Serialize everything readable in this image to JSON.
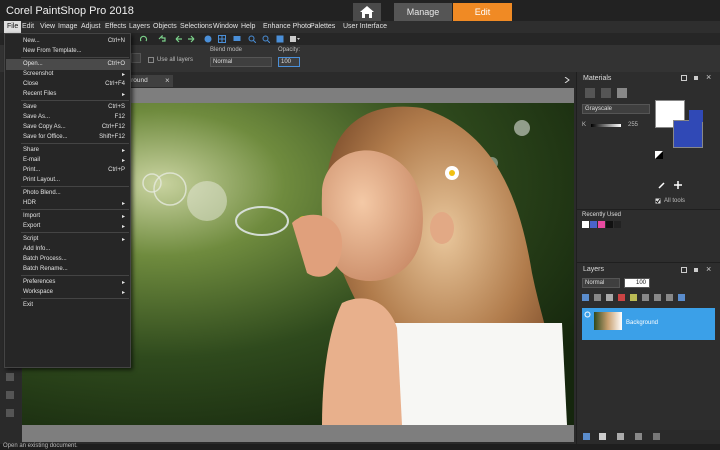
{
  "app": {
    "title": "Corel PaintShop Pro 2018",
    "home_icon": "home-icon",
    "tabs": [
      "Manage",
      "Edit"
    ],
    "active_tab": "Edit",
    "accent": "#f08a24"
  },
  "menubar": [
    "File",
    "Edit",
    "View",
    "Image",
    "Adjust",
    "Effects",
    "Layers",
    "Objects",
    "Selections",
    "Window",
    "Help",
    "Enhance Photo",
    "Palettes",
    "User Interface"
  ],
  "options": {
    "use_all_layers": "Use all layers",
    "blend_mode_label": "Blend mode",
    "blend_mode_value": "Normal",
    "opacity_label": "Opacity:",
    "opacity_value": "100"
  },
  "document": {
    "tab_name": "Background"
  },
  "file_menu": [
    {
      "label": "New...",
      "shortcut": "Ctrl+N"
    },
    {
      "label": "New From Template..."
    },
    {
      "sep": true
    },
    {
      "label": "Open...",
      "shortcut": "Ctrl+O",
      "highlighted": true
    },
    {
      "label": "Screenshot",
      "submenu": true
    },
    {
      "label": "Close",
      "shortcut": "Ctrl+F4"
    },
    {
      "label": "Recent Files",
      "submenu": true
    },
    {
      "sep": true
    },
    {
      "label": "Save",
      "shortcut": "Ctrl+S"
    },
    {
      "label": "Save As...",
      "shortcut": "F12"
    },
    {
      "label": "Save Copy As...",
      "shortcut": "Ctrl+F12"
    },
    {
      "label": "Save for Office...",
      "shortcut": "Shift+F12"
    },
    {
      "sep": true
    },
    {
      "label": "Share",
      "submenu": true
    },
    {
      "label": "E-mail",
      "submenu": true
    },
    {
      "label": "Print...",
      "shortcut": "Ctrl+P"
    },
    {
      "label": "Print Layout..."
    },
    {
      "sep": true
    },
    {
      "label": "Photo Blend..."
    },
    {
      "label": "HDR",
      "submenu": true
    },
    {
      "sep": true
    },
    {
      "label": "Import",
      "submenu": true
    },
    {
      "label": "Export",
      "submenu": true
    },
    {
      "sep": true
    },
    {
      "label": "Script",
      "submenu": true
    },
    {
      "label": "Add Info..."
    },
    {
      "label": "Batch Process..."
    },
    {
      "label": "Batch Rename..."
    },
    {
      "sep": true
    },
    {
      "label": "Preferences",
      "submenu": true
    },
    {
      "label": "Workspace",
      "submenu": true
    },
    {
      "sep": true
    },
    {
      "label": "Exit"
    }
  ],
  "materials": {
    "title": "Materials",
    "mode": "Grayscale",
    "k_label": "K",
    "k_value": "255",
    "all_tools": "All tools",
    "recently_used": "Recently Used",
    "recent_colors": [
      "#ffffff",
      "#4a63c9",
      "#e84aa0",
      "#111111",
      "#222222"
    ]
  },
  "layers": {
    "title": "Layers",
    "blend": "Normal",
    "opacity": "100",
    "layer_name": "Background",
    "highlight": "#3ba0e8"
  },
  "status": {
    "text": "Open an existing document."
  }
}
